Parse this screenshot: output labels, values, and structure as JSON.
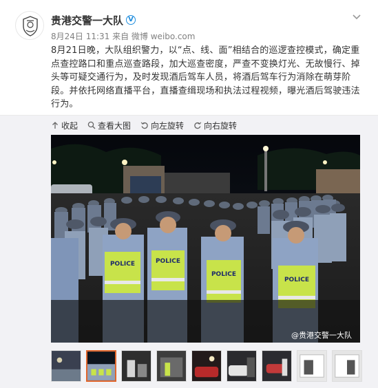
{
  "post": {
    "account_name": "贵港交警一大队",
    "verified_badge": "V",
    "meta": "8月24日 11:31 来自 微博 weibo.com",
    "text": "8月21日晚，大队组织警力，以“点、线、面”相结合的巡逻查控模式，确定重点查控路口和重点巡查路段，加大巡查密度，严查不变换灯光、无故慢行、掉头等可疑交通行为，及时发现酒后驾车人员，将酒后驾车行为消除在萌芽阶段。并依托网络直播平台，直播查缉现场和执法过程视频，曝光酒后驾驶违法行为。"
  },
  "toolbar": {
    "collapse": "收起",
    "view_large": "查看大图",
    "rotate_left": "向左旋转",
    "rotate_right": "向右旋转"
  },
  "photo": {
    "watermark": "@贵港交警一大队",
    "vest_text": "POLICE"
  },
  "thumbnails": {
    "count": 9,
    "active_index": 1
  },
  "icons": {
    "collapse": "arrow-up-icon",
    "view_large": "magnifier-icon",
    "rotate_left": "rotate-left-icon",
    "rotate_right": "rotate-right-icon",
    "menu": "chevron-down-icon"
  },
  "colors": {
    "verified": "#1f8ddd",
    "active_thumb_border": "#e0652b",
    "vest": "#c8e34a"
  }
}
